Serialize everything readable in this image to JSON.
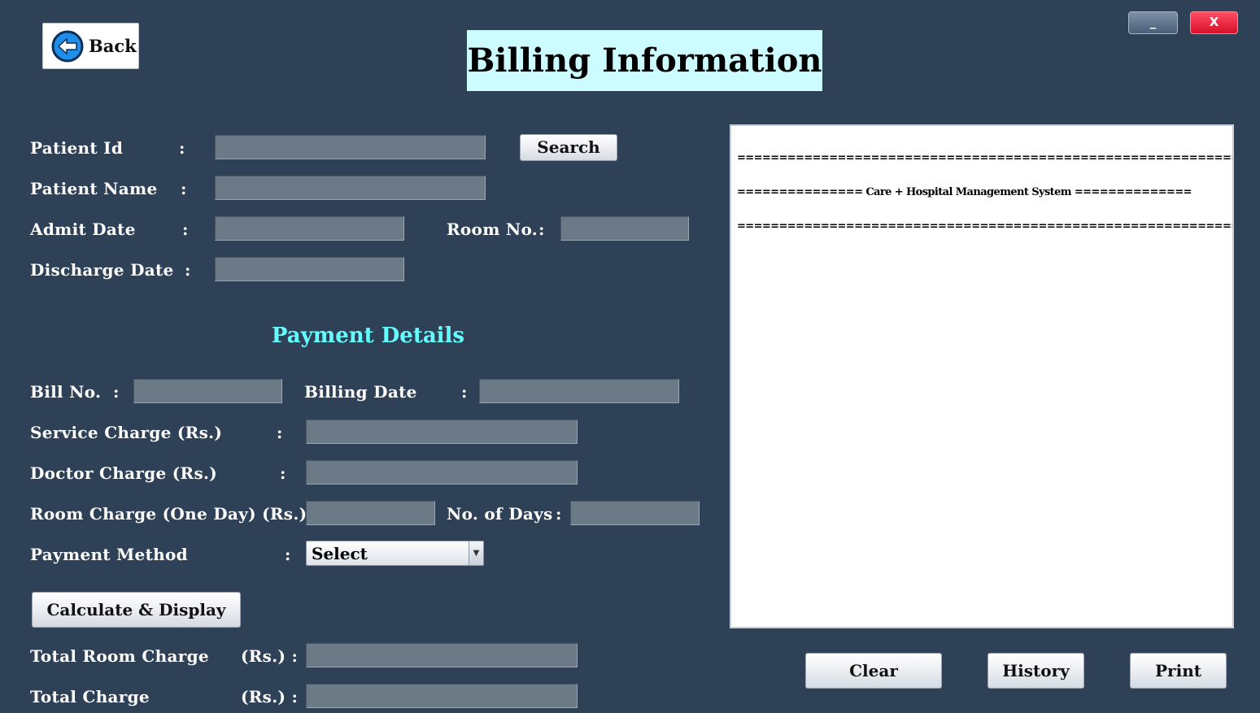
{
  "window": {
    "minimize_label": "_",
    "close_label": "X"
  },
  "header": {
    "back_label": "Back",
    "back_icon": "arrow-left-circle-icon",
    "title": "Billing Information"
  },
  "patient": {
    "patient_id_label": "Patient Id",
    "patient_id_value": "",
    "search_label": "Search",
    "patient_name_label": "Patient Name",
    "patient_name_value": "",
    "admit_date_label": "Admit Date",
    "admit_date_value": "",
    "room_no_label": "Room No.",
    "room_no_value": "",
    "discharge_date_label": "Discharge Date",
    "discharge_date_value": ""
  },
  "payment": {
    "section_title": "Payment Details",
    "bill_no_label": "Bill No.",
    "bill_no_value": "",
    "billing_date_label": "Billing Date",
    "billing_date_value": "",
    "service_charge_label": "Service Charge (Rs.)",
    "service_charge_value": "",
    "doctor_charge_label": "Doctor Charge (Rs.)",
    "doctor_charge_value": "",
    "room_charge_label": "Room Charge (One Day) (Rs.) :",
    "room_charge_value": "",
    "days_label": "No. of Days",
    "days_value": "",
    "payment_method_label": "Payment Method",
    "payment_method_selected": "Select",
    "calculate_label": "Calculate & Display",
    "total_room_charge_label": "Total Room Charge",
    "total_room_charge_unit": "(Rs.) :",
    "total_room_charge_value": "",
    "total_charge_label": "Total Charge",
    "total_charge_unit": "(Rs.) :",
    "total_charge_value": ""
  },
  "bill": {
    "line1": "=======================================================================",
    "line2": "=============== Care + Hospital Management System ==============",
    "line3": "======================================================================="
  },
  "actions": {
    "clear_label": "Clear",
    "history_label": "History",
    "print_label": "Print"
  },
  "colors": {
    "background": "#2f4156",
    "title_bg": "#ccfcff",
    "section_title": "#66ffff",
    "field_bg": "#6c7a88",
    "close_red": "#e8203a"
  }
}
